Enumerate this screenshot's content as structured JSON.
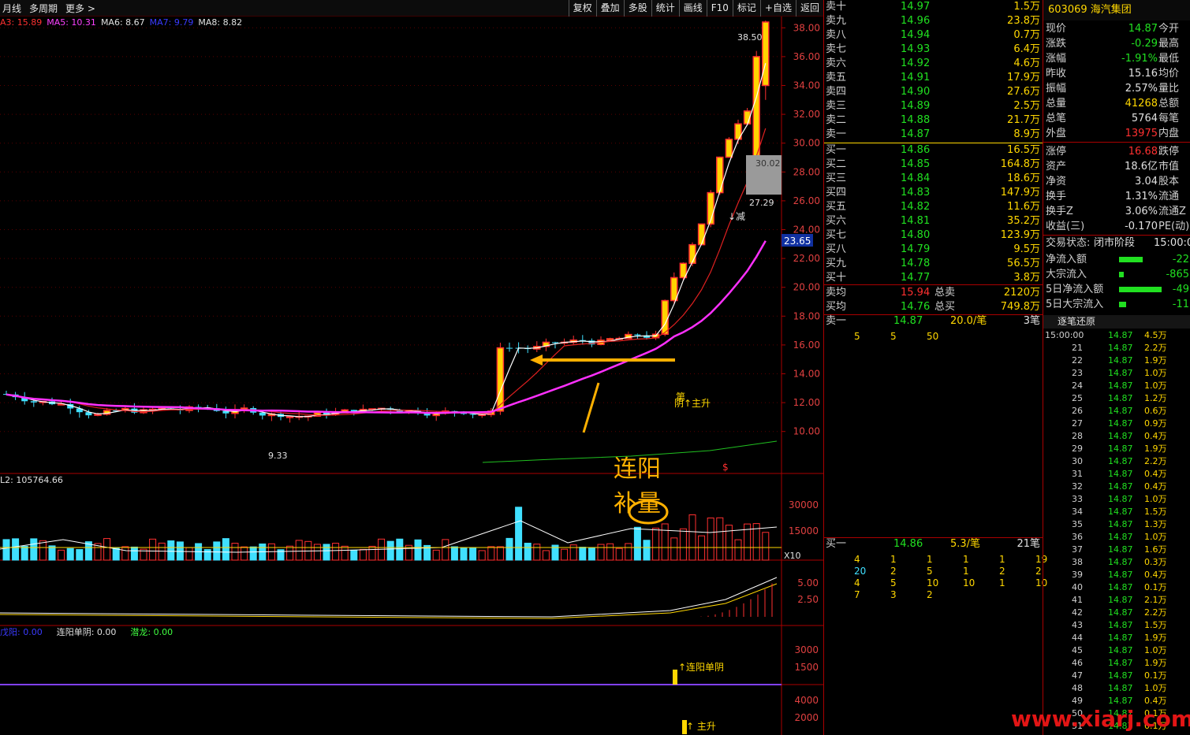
{
  "toolbar": {
    "left": [
      "月线",
      "多周期",
      "更多 >"
    ],
    "right": [
      "复权",
      "叠加",
      "多股",
      "统计",
      "画线",
      "F10",
      "标记",
      "+自选",
      "返回"
    ]
  },
  "ma_legend": [
    {
      "label": "A3: 15.89",
      "color": "#ff3030"
    },
    {
      "label": "MA5: 10.31",
      "color": "#ff40ff"
    },
    {
      "label": "MA6: 8.67",
      "color": "#e0e0e0"
    },
    {
      "label": "MA7: 9.79",
      "color": "#3a3aff"
    },
    {
      "label": "MA8: 8.82",
      "color": "#e0e0e0"
    }
  ],
  "price_axis": [
    "38.00",
    "36.00",
    "34.00",
    "32.00",
    "30.00",
    "28.00",
    "26.00",
    "24.00",
    "22.00",
    "20.00",
    "18.00",
    "16.00",
    "14.00",
    "12.00",
    "10.00"
  ],
  "price_labels": {
    "high": "38.50",
    "low": "9.33",
    "tag1": "30.02",
    "tag2": "27.29",
    "current": "23.65"
  },
  "vol_label": "L2: 105764.66",
  "vol_axis": [
    "30000",
    "15000"
  ],
  "vol_unit": "X10",
  "ind_axis": [
    "5.00",
    "2.50"
  ],
  "sig_legend": [
    {
      "label": "戊阳: 0.00",
      "color": "#3a3aff"
    },
    {
      "label": "连阳单阴: 0.00",
      "color": "#e0e0e0"
    },
    {
      "label": "潜龙: 0.00",
      "color": "#40ff40"
    }
  ],
  "sig_axis": [
    "3000",
    "1500"
  ],
  "sig_axis2": [
    "4000",
    "2000"
  ],
  "chart_marks": {
    "main_up": "阴↑主升",
    "first": "第",
    "reduce": "↓减",
    "sig1": "↑连阳单阴",
    "sig2": "↑   主升",
    "dollar": "$"
  },
  "annotation": {
    "line1": "连阳",
    "line2": "补量"
  },
  "order_book": {
    "sells": [
      {
        "name": "卖十",
        "price": "14.97",
        "vol": "1.5万"
      },
      {
        "name": "卖九",
        "price": "14.96",
        "vol": "23.8万"
      },
      {
        "name": "卖八",
        "price": "14.94",
        "vol": "0.7万"
      },
      {
        "name": "卖七",
        "price": "14.93",
        "vol": "6.4万"
      },
      {
        "name": "卖六",
        "price": "14.92",
        "vol": "4.6万"
      },
      {
        "name": "卖五",
        "price": "14.91",
        "vol": "17.9万"
      },
      {
        "name": "卖四",
        "price": "14.90",
        "vol": "27.6万"
      },
      {
        "name": "卖三",
        "price": "14.89",
        "vol": "2.5万"
      },
      {
        "name": "卖二",
        "price": "14.88",
        "vol": "21.7万"
      },
      {
        "name": "卖一",
        "price": "14.87",
        "vol": "8.9万"
      }
    ],
    "buys": [
      {
        "name": "买一",
        "price": "14.86",
        "vol": "16.5万"
      },
      {
        "name": "买二",
        "price": "14.85",
        "vol": "164.8万"
      },
      {
        "name": "买三",
        "price": "14.84",
        "vol": "18.6万"
      },
      {
        "name": "买四",
        "price": "14.83",
        "vol": "147.9万"
      },
      {
        "name": "买五",
        "price": "14.82",
        "vol": "11.6万"
      },
      {
        "name": "买六",
        "price": "14.81",
        "vol": "35.2万"
      },
      {
        "name": "买七",
        "price": "14.80",
        "vol": "123.9万"
      },
      {
        "name": "买八",
        "price": "14.79",
        "vol": "9.5万"
      },
      {
        "name": "买九",
        "price": "14.78",
        "vol": "56.5万"
      },
      {
        "name": "买十",
        "price": "14.77",
        "vol": "3.8万"
      }
    ],
    "avg_sell": {
      "name": "卖均",
      "price": "15.94",
      "label": "总卖",
      "vol": "2120万"
    },
    "avg_buy": {
      "name": "买均",
      "price": "14.76",
      "label": "总买",
      "vol": "749.8万"
    },
    "sell1_detail": {
      "name": "卖一",
      "price": "14.87",
      "per": "20.0/笔",
      "count": "3笔",
      "queue": [
        "5",
        "5",
        "50"
      ]
    },
    "buy1_detail": {
      "name": "买一",
      "price": "14.86",
      "per": "5.3/笔",
      "count": "21笔",
      "queue": [
        [
          "4",
          "1",
          "1",
          "1",
          "1",
          "19"
        ],
        [
          "20",
          "2",
          "5",
          "1",
          "2",
          "2"
        ],
        [
          "4",
          "5",
          "10",
          "10",
          "1",
          "10"
        ],
        [
          "7",
          "3",
          "2",
          "",
          "",
          ""
        ]
      ]
    }
  },
  "stock": {
    "code": "603069",
    "name": "海汽集团"
  },
  "quote": [
    {
      "k": "现价",
      "v": "14.87",
      "c": "#21e021",
      "k2": "今开"
    },
    {
      "k": "涨跌",
      "v": "-0.29",
      "c": "#21e021",
      "k2": "最高"
    },
    {
      "k": "涨幅",
      "v": "-1.91%",
      "c": "#21e021",
      "k2": "最低"
    },
    {
      "k": "昨收",
      "v": "15.16",
      "c": "#e0e0e0",
      "k2": "均价"
    },
    {
      "k": "振幅",
      "v": "2.57%",
      "c": "#e0e0e0",
      "k2": "量比"
    },
    {
      "k": "总量",
      "v": "41268",
      "c": "#ffd700",
      "k2": "总额"
    },
    {
      "k": "总笔",
      "v": "5764",
      "c": "#e0e0e0",
      "k2": "每笔"
    },
    {
      "k": "外盘",
      "v": "13975",
      "c": "#ff3030",
      "k2": "内盘"
    },
    {
      "k": "涨停",
      "v": "16.68",
      "c": "#ff3030",
      "k2": "跌停"
    },
    {
      "k": "资产",
      "v": "18.6亿",
      "c": "#e0e0e0",
      "k2": "市值"
    },
    {
      "k": "净资",
      "v": "3.04",
      "c": "#e0e0e0",
      "k2": "股本"
    },
    {
      "k": "换手",
      "v": "1.31%",
      "c": "#e0e0e0",
      "k2": "流通"
    },
    {
      "k": "换手Z",
      "v": "3.06%",
      "c": "#e0e0e0",
      "k2": "流通Z"
    },
    {
      "k": "收益(三)",
      "v": "-0.170",
      "c": "#e0e0e0",
      "k2": "PE(动)"
    }
  ],
  "status": {
    "label": "交易状态:",
    "value": "闭市阶段",
    "time": "15:00:0"
  },
  "flows": [
    {
      "k": "净流入额",
      "v": "-22",
      "w": 0.5
    },
    {
      "k": "大宗流入",
      "v": "-865",
      "w": 0.1
    },
    {
      "k": "5日净流入额",
      "v": "-49",
      "w": 0.9
    },
    {
      "k": "5日大宗流入",
      "v": "-11",
      "w": 0.15
    }
  ],
  "tick_header": "逐笔还原",
  "ticks": [
    {
      "t": "15:00:00",
      "p": "14.87",
      "q": "4.5万"
    },
    {
      "t": "21",
      "p": "14.87",
      "q": "2.2万"
    },
    {
      "t": "22",
      "p": "14.87",
      "q": "1.9万"
    },
    {
      "t": "23",
      "p": "14.87",
      "q": "1.0万"
    },
    {
      "t": "24",
      "p": "14.87",
      "q": "1.0万"
    },
    {
      "t": "25",
      "p": "14.87",
      "q": "1.2万"
    },
    {
      "t": "26",
      "p": "14.87",
      "q": "0.6万"
    },
    {
      "t": "27",
      "p": "14.87",
      "q": "0.9万"
    },
    {
      "t": "28",
      "p": "14.87",
      "q": "0.4万"
    },
    {
      "t": "29",
      "p": "14.87",
      "q": "1.9万"
    },
    {
      "t": "30",
      "p": "14.87",
      "q": "2.2万"
    },
    {
      "t": "31",
      "p": "14.87",
      "q": "0.4万"
    },
    {
      "t": "32",
      "p": "14.87",
      "q": "0.4万"
    },
    {
      "t": "33",
      "p": "14.87",
      "q": "1.0万"
    },
    {
      "t": "34",
      "p": "14.87",
      "q": "1.5万"
    },
    {
      "t": "35",
      "p": "14.87",
      "q": "1.3万"
    },
    {
      "t": "36",
      "p": "14.87",
      "q": "1.0万"
    },
    {
      "t": "37",
      "p": "14.87",
      "q": "1.6万"
    },
    {
      "t": "38",
      "p": "14.87",
      "q": "0.3万"
    },
    {
      "t": "39",
      "p": "14.87",
      "q": "0.4万"
    },
    {
      "t": "40",
      "p": "14.87",
      "q": "0.1万"
    },
    {
      "t": "41",
      "p": "14.87",
      "q": "2.1万"
    },
    {
      "t": "42",
      "p": "14.87",
      "q": "2.2万"
    },
    {
      "t": "43",
      "p": "14.87",
      "q": "1.5万"
    },
    {
      "t": "44",
      "p": "14.87",
      "q": "1.9万"
    },
    {
      "t": "45",
      "p": "14.87",
      "q": "1.0万"
    },
    {
      "t": "46",
      "p": "14.87",
      "q": "1.9万"
    },
    {
      "t": "47",
      "p": "14.87",
      "q": "0.1万"
    },
    {
      "t": "48",
      "p": "14.87",
      "q": "1.0万"
    },
    {
      "t": "49",
      "p": "14.87",
      "q": "0.4万"
    },
    {
      "t": "50",
      "p": "14.87",
      "q": "0.1万"
    },
    {
      "t": "51",
      "p": "14.87",
      "q": "0.1万"
    }
  ],
  "watermark": "www.xiarj.com"
}
